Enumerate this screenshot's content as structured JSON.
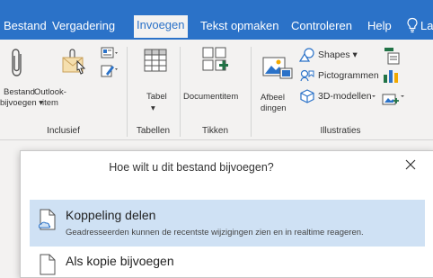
{
  "tabs": [
    {
      "label": "Bestand",
      "active": false
    },
    {
      "label": "Vergadering",
      "active": false
    },
    {
      "label": "Invoegen",
      "active": true
    },
    {
      "label": "Tekst opmaken",
      "active": false
    },
    {
      "label": "Controleren",
      "active": false
    },
    {
      "label": "Help",
      "active": false
    }
  ],
  "tell_me_label": "La",
  "ribbon": {
    "bestand_line1": "Bestand",
    "bestand_line2": "bijvoegen ▾",
    "outlook_line1": "Outlook-",
    "outlook_line2": "item",
    "tabel_label": "Tabel",
    "tabel_arrow": "▾",
    "documentitem_label": "Documentitem",
    "afbeeldingen_line1": "Afbeel",
    "afbeeldingen_line2": "dingen",
    "shapes_label": "Shapes ▾",
    "pictogrammen_label": "Pictogrammen",
    "modellen_label": "3D-modellen",
    "groups": {
      "inclusief": "Inclusief",
      "tabellen": "Tabellen",
      "tikken": "Tikken",
      "illustraties": "Illustraties"
    }
  },
  "dialog": {
    "title": "Hoe wilt u dit bestand bijvoegen?",
    "close_glyph": "✕",
    "options": [
      {
        "title": "Koppeling delen",
        "description": "Geadresseerden kunnen de recentste wijzigingen zien en in realtime reageren."
      },
      {
        "title": "Als kopie bijvoegen",
        "description": ""
      }
    ]
  },
  "colors": {
    "accent": "#2b72c8",
    "ribbon_bg": "#f3f2f1",
    "selected_option": "#cfe1f4",
    "icon_blue": "#2b72c8",
    "icon_green": "#217346"
  }
}
